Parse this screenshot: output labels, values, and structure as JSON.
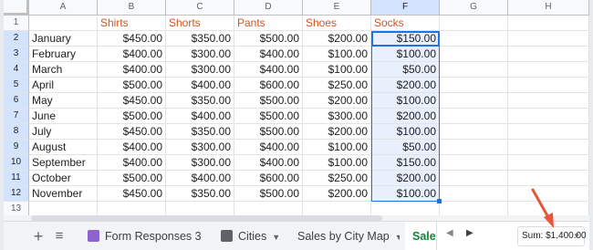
{
  "columns": [
    "A",
    "B",
    "C",
    "D",
    "E",
    "F",
    "G",
    "H"
  ],
  "header_row": {
    "number": "1",
    "cells": [
      "",
      "Shirts",
      "Shorts",
      "Pants",
      "Shoes",
      "Socks",
      "",
      ""
    ]
  },
  "rows": [
    {
      "number": "2",
      "cells": [
        "January",
        "$450.00",
        "$350.00",
        "$500.00",
        "$200.00",
        "$150.00"
      ]
    },
    {
      "number": "3",
      "cells": [
        "February",
        "$400.00",
        "$300.00",
        "$400.00",
        "$100.00",
        "$100.00"
      ]
    },
    {
      "number": "4",
      "cells": [
        "March",
        "$400.00",
        "$300.00",
        "$400.00",
        "$100.00",
        "$50.00"
      ]
    },
    {
      "number": "5",
      "cells": [
        "April",
        "$500.00",
        "$400.00",
        "$600.00",
        "$250.00",
        "$200.00"
      ]
    },
    {
      "number": "6",
      "cells": [
        "May",
        "$450.00",
        "$350.00",
        "$500.00",
        "$200.00",
        "$100.00"
      ]
    },
    {
      "number": "7",
      "cells": [
        "June",
        "$500.00",
        "$400.00",
        "$500.00",
        "$300.00",
        "$200.00"
      ]
    },
    {
      "number": "8",
      "cells": [
        "July",
        "$450.00",
        "$350.00",
        "$500.00",
        "$200.00",
        "$100.00"
      ]
    },
    {
      "number": "9",
      "cells": [
        "August",
        "$400.00",
        "$300.00",
        "$400.00",
        "$100.00",
        "$50.00"
      ]
    },
    {
      "number": "10",
      "cells": [
        "September",
        "$400.00",
        "$300.00",
        "$400.00",
        "$100.00",
        "$150.00"
      ]
    },
    {
      "number": "11",
      "cells": [
        "October",
        "$500.00",
        "$400.00",
        "$600.00",
        "$250.00",
        "$200.00"
      ]
    },
    {
      "number": "12",
      "cells": [
        "November",
        "$450.00",
        "$350.00",
        "$500.00",
        "$200.00",
        "$100.00"
      ]
    },
    {
      "number": "13",
      "cells": [
        "",
        "",
        "",
        "",
        "",
        ""
      ]
    }
  ],
  "selection": {
    "column": "F",
    "from_row": "2",
    "to_row": "12"
  },
  "tabs": {
    "add_icon": "plus-icon",
    "list_icon": "menu-icon",
    "items": [
      {
        "label": "Form Responses 3",
        "icon": "form-icon",
        "icon_color": "#8e63ce"
      },
      {
        "label": "Cities",
        "icon": "pivot-icon",
        "icon_color": "#5f6368"
      },
      {
        "label": "Sales by City Map",
        "icon": "",
        "icon_color": ""
      },
      {
        "label": "Sales",
        "icon": "",
        "icon_color": ""
      }
    ],
    "active_color": "#188038"
  },
  "status": {
    "sum": "Sum: $1,400.00"
  },
  "colors": {
    "header_text": "#d2541b",
    "selection_border": "#1a73e8",
    "selection_fill": "#e8f0fe",
    "arrow": "#e8553a"
  }
}
